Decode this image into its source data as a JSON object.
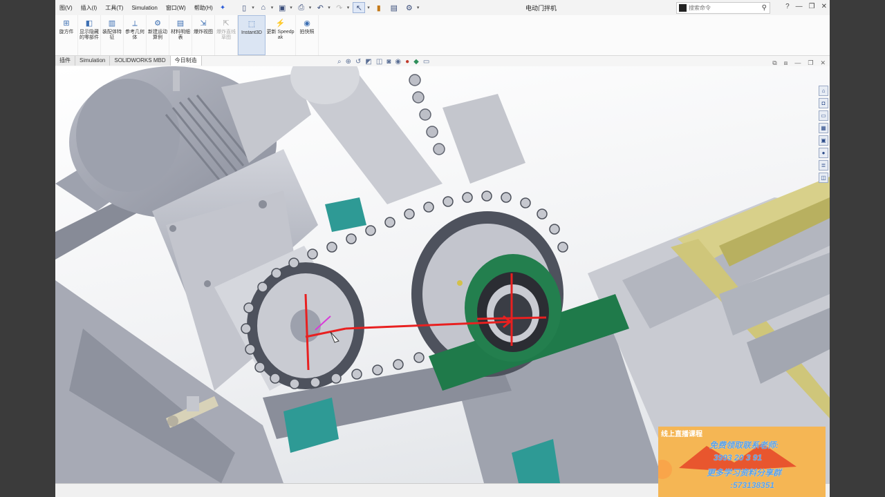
{
  "menubar": {
    "items": [
      "图(V)",
      "插入(I)",
      "工具(T)",
      "Simulation",
      "窗口(W)",
      "帮助(H)"
    ],
    "pin_icon": "pin-icon"
  },
  "quick_access": {
    "icons": [
      "new-document-icon",
      "open-icon",
      "save-icon",
      "print-icon",
      "undo-icon",
      "redo-icon",
      "select-icon",
      "rebuild-icon",
      "file-properties-icon",
      "options-icon"
    ]
  },
  "document_title": "电动门拌机",
  "search": {
    "placeholder": "搜索命令"
  },
  "window_controls": [
    "search-icon",
    "help-icon",
    "minimize-icon",
    "restore-icon",
    "close-icon"
  ],
  "command_manager": {
    "items": [
      {
        "label": "旋方件",
        "icon": "mate-icon"
      },
      {
        "label": "显示隐藏的零部件",
        "icon": "show-hidden-icon"
      },
      {
        "label": "装配体特征",
        "icon": "assembly-feature-icon"
      },
      {
        "label": "参考几何体",
        "icon": "reference-geometry-icon"
      },
      {
        "label": "新建运动算例",
        "icon": "motion-study-icon"
      },
      {
        "label": "材料明细表",
        "icon": "bom-icon"
      },
      {
        "label": "爆炸视图",
        "icon": "explode-icon"
      },
      {
        "label": "爆炸直线草图",
        "icon": "explode-sketch-icon"
      },
      {
        "label": "Instant3D",
        "icon": "instant3d-icon"
      },
      {
        "label": "更新 Speedpak",
        "icon": "speedpak-icon"
      },
      {
        "label": "拍快照",
        "icon": "snapshot-icon"
      }
    ]
  },
  "tabs": [
    "插件",
    "Simulation",
    "SOLIDWORKS MBD",
    "今日制造"
  ],
  "heads_up_icons": [
    "zoom-fit-icon",
    "zoom-area-icon",
    "previous-view-icon",
    "section-view-icon",
    "view-orientation-icon",
    "display-style-icon",
    "hide-show-icon",
    "appearance-icon",
    "scene-icon",
    "view-settings-icon"
  ],
  "viewport_controls": [
    "tile-icon",
    "split-icon",
    "minimize-icon",
    "restore-icon",
    "close-icon"
  ],
  "task_pane": [
    "home-icon",
    "resources-icon",
    "design-library-icon",
    "file-explorer-icon",
    "view-palette-icon",
    "appearances-icon",
    "custom-properties-icon",
    "forum-icon"
  ],
  "promo": {
    "header": "线上直播课程",
    "line1": "免费领取联系老师:",
    "line2": "3993 20 3 91",
    "line3": "更多学习资料分享群",
    "line4": ":573138351"
  },
  "colors": {
    "accent": "#2a5bd7",
    "bearing_green": "#1f7a4a",
    "base_teal": "#2e9a95",
    "rail_yellow": "#d8d08a",
    "promo_bg": "#f5b654",
    "annotation_red": "#e82020"
  }
}
